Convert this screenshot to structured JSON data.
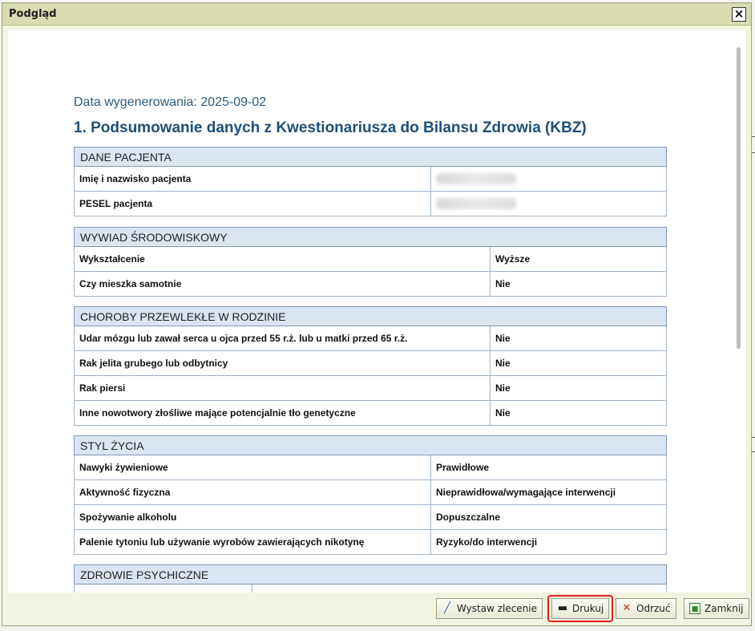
{
  "window": {
    "title": "Podgląd",
    "close_label": "✕"
  },
  "document": {
    "generated_date": "Data wygenerowania: 2025-09-02",
    "heading": "1. Podsumowanie danych z Kwestionariusza do Bilansu Zdrowia (KBZ)",
    "sections": [
      {
        "title": "DANE PACJENTA",
        "rows": [
          {
            "label": "Imię i nazwisko pacjenta",
            "value": ""
          },
          {
            "label": "PESEL pacjenta",
            "value": ""
          }
        ]
      },
      {
        "title": "WYWIAD ŚRODOWISKOWY",
        "rows": [
          {
            "label": "Wykształcenie",
            "value": "Wyższe"
          },
          {
            "label": "Czy mieszka samotnie",
            "value": "Nie"
          }
        ]
      },
      {
        "title": "CHOROBY PRZEWLEKŁE W RODZINIE",
        "rows": [
          {
            "label": "Udar mózgu lub zawał serca u ojca przed 55 r.ż. lub u matki przed 65 r.ż.",
            "value": "Nie"
          },
          {
            "label": "Rak jelita grubego lub odbytnicy",
            "value": "Nie"
          },
          {
            "label": "Rak piersi",
            "value": "Nie"
          },
          {
            "label": "Inne nowotwory złośliwe mające potencjalnie tło genetyczne",
            "value": "Nie"
          }
        ]
      },
      {
        "title": "STYL ŻYCIA",
        "rows": [
          {
            "label": "Nawyki żywieniowe",
            "value": "Prawidłowe"
          },
          {
            "label": "Aktywność fizyczna",
            "value": "Nieprawidłowa/wymagające interwencji"
          },
          {
            "label": "Spożywanie alkoholu",
            "value": "Dopuszczalne"
          },
          {
            "label": "Palenie tytoniu lub używanie wyrobów zawierających nikotynę",
            "value": "Ryzyko/do interwencji"
          }
        ]
      },
      {
        "title": "ZDROWIE PSYCHICZNE",
        "rows": []
      }
    ]
  },
  "footer": {
    "issue_order_label": "Wystaw zlecenie",
    "print_label": "Drukuj",
    "reject_label": "Odrzuć",
    "close_label": "Zamknij"
  },
  "colors": {
    "accent_highlight": "#e02020",
    "heading": "#1f4e79",
    "section_bg": "#dbe5f1"
  }
}
